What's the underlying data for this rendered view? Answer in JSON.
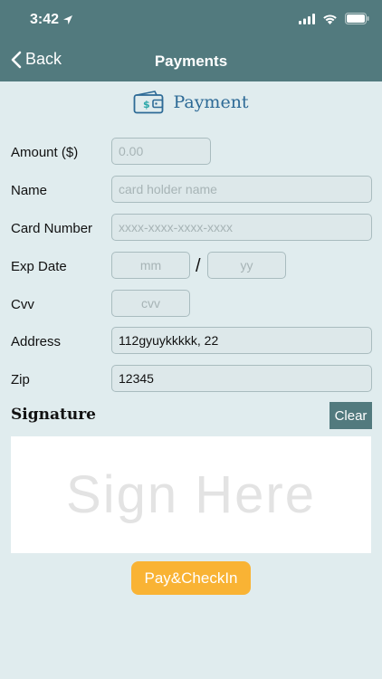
{
  "status_bar": {
    "time": "3:42"
  },
  "nav": {
    "back_label": "Back",
    "title": "Payments"
  },
  "section": {
    "title": "Payment"
  },
  "form": {
    "amount": {
      "label": "Amount ($)",
      "value": "",
      "placeholder": "0.00"
    },
    "name": {
      "label": "Name",
      "value": "",
      "placeholder": "card holder name"
    },
    "card_number": {
      "label": "Card Number",
      "value": "",
      "placeholder": "xxxx-xxxx-xxxx-xxxx"
    },
    "exp_date": {
      "label": "Exp Date",
      "month_placeholder": "mm",
      "separator": "/",
      "year_placeholder": "yy"
    },
    "cvv": {
      "label": "Cvv",
      "value": "",
      "placeholder": "cvv"
    },
    "address": {
      "label": "Address",
      "value": "112gyuykkkkk, 22",
      "placeholder": ""
    },
    "zip": {
      "label": "Zip",
      "value": "12345",
      "placeholder": ""
    }
  },
  "signature": {
    "label": "Signature",
    "clear_label": "Clear",
    "pad_text": "Sign Here"
  },
  "actions": {
    "pay_label": "Pay&CheckIn"
  },
  "colors": {
    "header": "#527a7e",
    "background": "#e0ecee",
    "accent": "#f9b334",
    "title_blue": "#2d6a96"
  },
  "icons": {
    "wallet": "wallet-icon",
    "back": "chevron-left-icon"
  }
}
